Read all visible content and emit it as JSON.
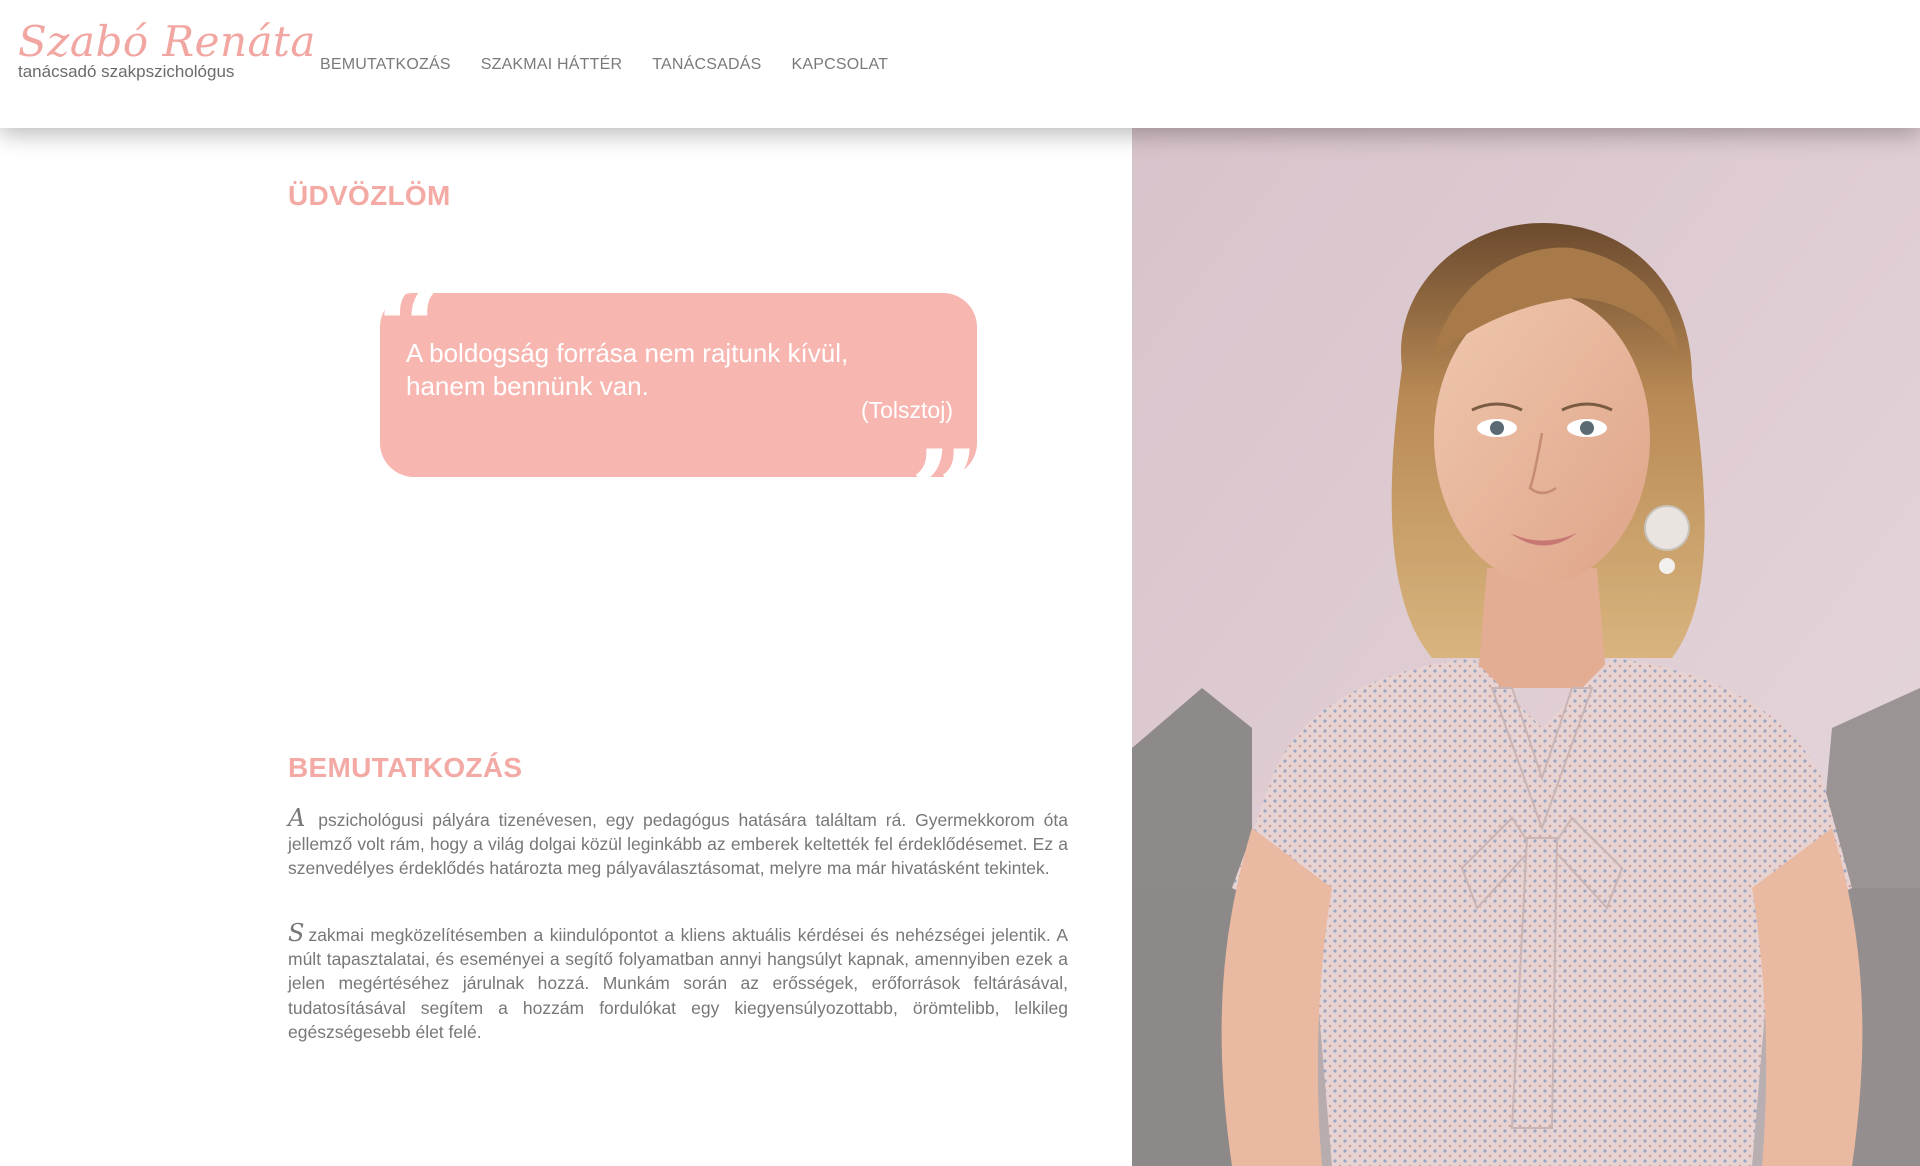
{
  "brand": {
    "name": "Szabó Renáta",
    "tagline": "tanácsadó szakpszichológus"
  },
  "nav": {
    "items": [
      {
        "label": "BEMUTATKOZÁS"
      },
      {
        "label": "SZAKMAI HÁTTÉR"
      },
      {
        "label": "TANÁCSADÁS"
      },
      {
        "label": "KAPCSOLAT"
      }
    ]
  },
  "welcome": {
    "title": "ÜDVÖZLÖM",
    "quote": {
      "text": "A boldogság forrása nem rajtunk kívül, hanem bennünk van.",
      "author": "(Tolsztoj)"
    }
  },
  "about": {
    "title": "BEMUTATKOZÁS",
    "paragraphs": [
      {
        "initial": "A",
        "text": "pszichológusi pályára tizenévesen, egy pedagógus hatására találtam rá. Gyermekkorom óta jellemző volt rám, hogy a világ dolgai közül leginkább az emberek keltették fel érdeklődésemet. Ez a szenvedélyes érdeklődés határozta meg pályaválasztásomat, melyre ma már hivatásként tekintek."
      },
      {
        "initial": "S",
        "text": "zakmai megközelítésemben a kiindulópontot a kliens aktuális kérdései és nehézségei jelentik. A múlt tapasztalatai, és eseményei a segítő folyamatban annyi hangsúlyt kapnak, amennyiben ezek a jelen megértéséhez járulnak hozzá. Munkám során az erősségek, erőforrások feltárásával, tudatosításával segítem a hozzám fordulókat egy kiegyensúlyozottabb, örömtelibb, lelkileg egészségesebb élet felé."
      }
    ]
  },
  "colors": {
    "accent": "#f4aaa4",
    "quote_bg": "#f8b6b1",
    "text": "#777777",
    "nav_text": "#7a7a7a"
  }
}
